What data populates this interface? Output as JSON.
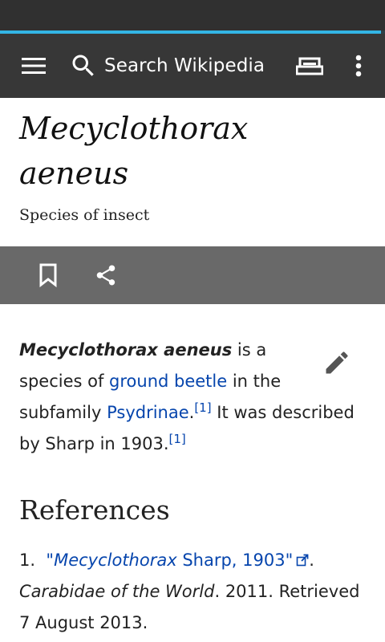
{
  "colors": {
    "status_bar": "#303030",
    "toolbar": "#373737",
    "progress": "#33b5e5",
    "action_bar": "#696969",
    "link": "#0645ad",
    "text": "#222222"
  },
  "load_progress": 0.99,
  "toolbar": {
    "menu_icon": "hamburger-menu-icon",
    "search_icon": "search-icon",
    "search_placeholder": "Search Wikipedia",
    "reading_list_icon": "reading-list-icon",
    "overflow_icon": "more-vertical-icon"
  },
  "page": {
    "title_line1": "Mecyclothorax",
    "title_line2": "aeneus",
    "description": "Species of insect"
  },
  "actions": {
    "bookmark_icon": "bookmark-icon",
    "share_icon": "share-icon",
    "edit_icon": "edit-pencil-icon"
  },
  "article": {
    "lead_bold": "Mecyclothorax aeneus",
    "text1": " is a",
    "text2": "species of ",
    "link_ground_beetle": "ground beetle",
    "text3": " in the",
    "text4": "subfamily ",
    "link_psydrinae": "Psydrinae",
    "text5": ".",
    "ref1": "[1]",
    "text6": " It was described",
    "text7": "by Sharp in 1903.",
    "ref2": "[1]"
  },
  "references": {
    "heading": "References",
    "items": [
      {
        "number": "1.",
        "link_open_quote": "\"",
        "link_italic": "Mecyclothorax",
        "link_rest": " Sharp, 1903\"",
        "after_link": ".",
        "work": "Carabidae of the World",
        "rest_line2": ". 2011. Retrieved",
        "line3": "7 August 2013."
      }
    ]
  }
}
